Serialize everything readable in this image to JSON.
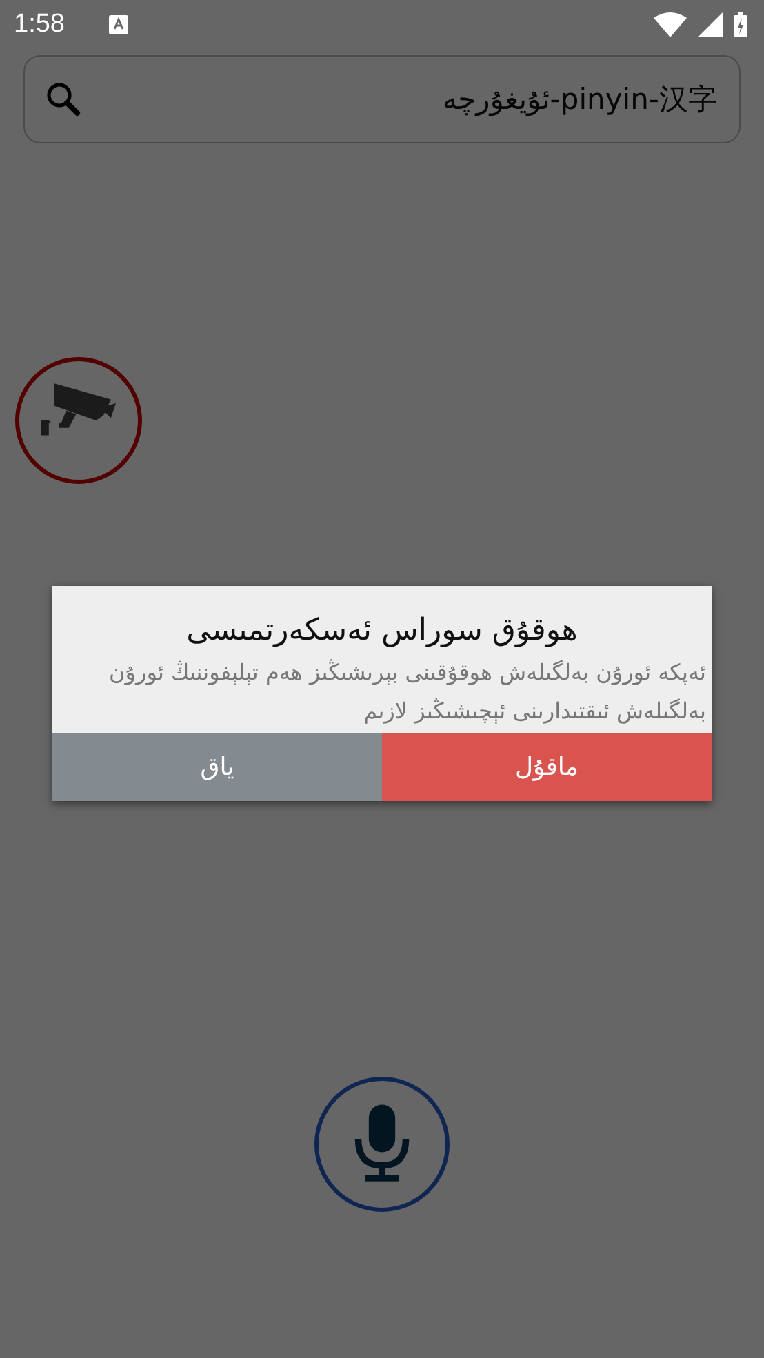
{
  "status_bar": {
    "time": "1:58"
  },
  "search": {
    "placeholder": "ئۇيغۇرچە-pinyin-汉字"
  },
  "dialog": {
    "title": "هوقۇق سوراس ئەسكەرتمىسى",
    "message": "ئەپكە ئورۇن بەلگىلەش هوقۇقىنى بېرىشىڭىز ھەم تېلېفوننىڭ ئورۇن بەلگىلەش ئىقتىدارىنى ئېچىشىڭىز لازىم",
    "buttons": [
      {
        "label": "ماقۇل",
        "kind": "confirm"
      },
      {
        "label": "ياق",
        "kind": "cancel"
      }
    ]
  }
}
